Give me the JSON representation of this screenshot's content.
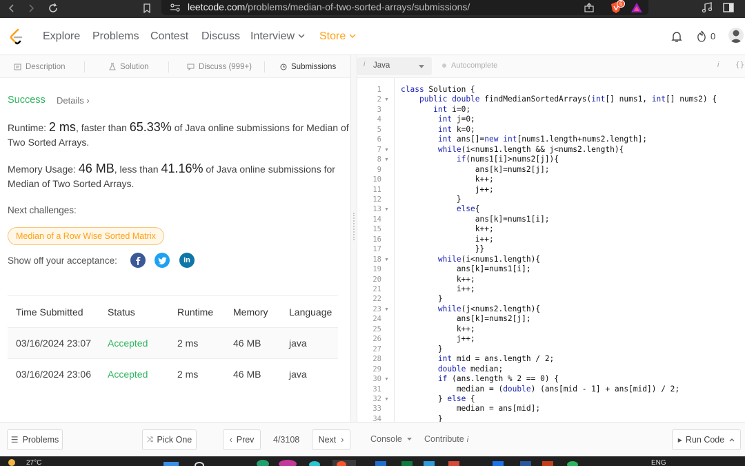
{
  "browser": {
    "url_domain": "leetcode.com",
    "url_path": "/problems/median-of-two-sorted-arrays/submissions/",
    "brave_badge": "6"
  },
  "header": {
    "nav": [
      "Explore",
      "Problems",
      "Contest",
      "Discuss",
      "Interview",
      "Store"
    ],
    "coins": "0"
  },
  "tabs": [
    "Description",
    "Solution",
    "Discuss (999+)",
    "Submissions"
  ],
  "result": {
    "status": "Success",
    "details_link": "Details",
    "runtime_label": "Runtime:",
    "runtime_value": "2 ms",
    "runtime_mid": ", faster than",
    "runtime_pct": "65.33%",
    "runtime_tail1": "of Java online submissions for Median of",
    "runtime_tail2": "Two Sorted Arrays.",
    "memory_label": "Memory Usage:",
    "memory_value": "46 MB",
    "memory_mid": ", less than",
    "memory_pct": "41.16%",
    "memory_tail1": "of Java online submissions for",
    "memory_tail2": "Median of Two Sorted Arrays.",
    "next_challenges": "Next challenges:",
    "challenge": "Median of a Row Wise Sorted Matrix",
    "share_label": "Show off your acceptance:"
  },
  "table": {
    "headers": [
      "Time Submitted",
      "Status",
      "Runtime",
      "Memory",
      "Language"
    ],
    "rows": [
      [
        "03/16/2024 23:07",
        "Accepted",
        "2 ms",
        "46 MB",
        "java"
      ],
      [
        "03/16/2024 23:06",
        "Accepted",
        "2 ms",
        "46 MB",
        "java"
      ]
    ]
  },
  "editor": {
    "language": "Java",
    "autocomplete": "Autocomplete",
    "code": [
      "class Solution {",
      "    public double findMedianSortedArrays(int[] nums1, int[] nums2) {",
      "       int i=0;",
      "        int j=0;",
      "        int k=0;",
      "        int ans[]=new int[nums1.length+nums2.length];",
      "        while(i<nums1.length && j<nums2.length){",
      "            if(nums1[i]>nums2[j]){",
      "                ans[k]=nums2[j];",
      "                k++;",
      "                j++;",
      "            }",
      "            else{",
      "                ans[k]=nums1[i];",
      "                k++;",
      "                i++;",
      "                }}",
      "        while(i<nums1.length){",
      "            ans[k]=nums1[i];",
      "            k++;",
      "            i++;",
      "        }",
      "        while(j<nums2.length){",
      "            ans[k]=nums2[j];",
      "            k++;",
      "            j++;",
      "        }",
      "        int mid = ans.length / 2;",
      "        double median;",
      "        if (ans.length % 2 == 0) {",
      "            median = (double) (ans[mid - 1] + ans[mid]) / 2;",
      "        } else {",
      "            median = ans[mid];",
      "        }"
    ],
    "fold_lines": [
      2,
      7,
      8,
      13,
      18,
      23,
      30,
      32
    ]
  },
  "bottom": {
    "problems": "Problems",
    "pick_one": "Pick One",
    "prev": "Prev",
    "page": "4/3108",
    "next": "Next",
    "console": "Console",
    "contribute": "Contribute",
    "run_code": "Run Code"
  },
  "taskbar": {
    "temp": "27°C",
    "lang": "ENG"
  }
}
